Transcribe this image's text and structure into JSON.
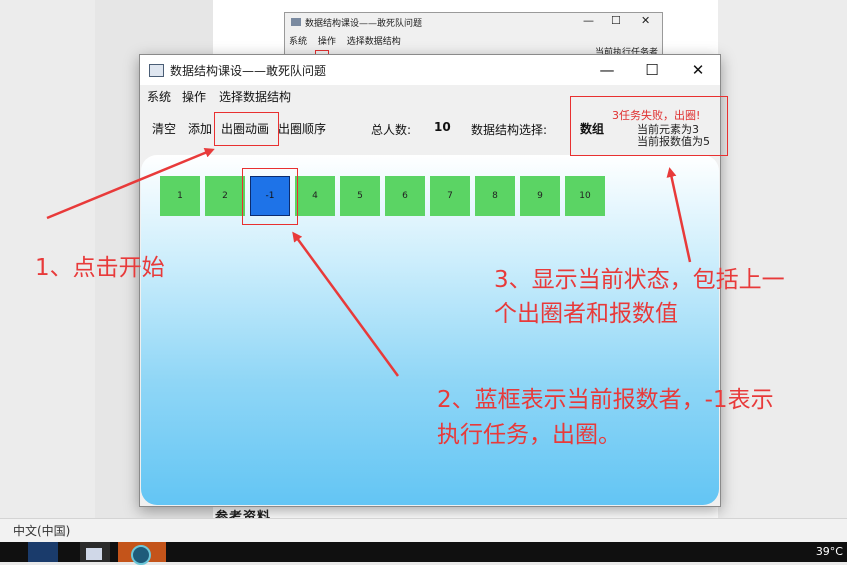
{
  "background_app": {
    "title": "数据结构课设——敢死队问题",
    "menu": [
      "系统",
      "操作",
      "选择数据结构"
    ],
    "status": "当前执行任务者",
    "controls": [
      "—",
      "☐",
      "✕"
    ]
  },
  "window": {
    "title": "数据结构课设——敢死队问题",
    "controls": {
      "minimize": "—",
      "maximize": "☐",
      "close": "✕"
    },
    "menu": {
      "system": "系统",
      "operate": "操作",
      "select_ds": "选择数据结构"
    },
    "toolbar": {
      "clear": "清空",
      "add": "添加",
      "animate": "出圈动画",
      "order": "出圈顺序",
      "total_label": "总人数:",
      "total_value": "10",
      "ds_label": "数据结构选择:",
      "ds_value": "数组",
      "fail_text": "3任务失败，出圈!",
      "current_element": "当前元素为3",
      "current_count": "当前报数值为5"
    },
    "cells": [
      "1",
      "2",
      "-1",
      "4",
      "5",
      "6",
      "7",
      "8",
      "9",
      "10"
    ],
    "active_cell_index": 2
  },
  "annotations": {
    "step1": "1、点击开始",
    "step2_line1": "2、蓝框表示当前报数者，-1表示",
    "step2_line2": "执行任务，出圈。",
    "step3_line1": "3、显示当前状态，包括上一",
    "step3_line2": "个出圈者和报数值"
  },
  "document": {
    "partial_heading": "参考资料"
  },
  "statusbar": {
    "language": "中文(中国)"
  },
  "taskbar": {
    "temperature": "39°C"
  },
  "colors": {
    "annotation": "#e83a3a",
    "cell": "#5bd464",
    "active_cell": "#1e73e8"
  }
}
